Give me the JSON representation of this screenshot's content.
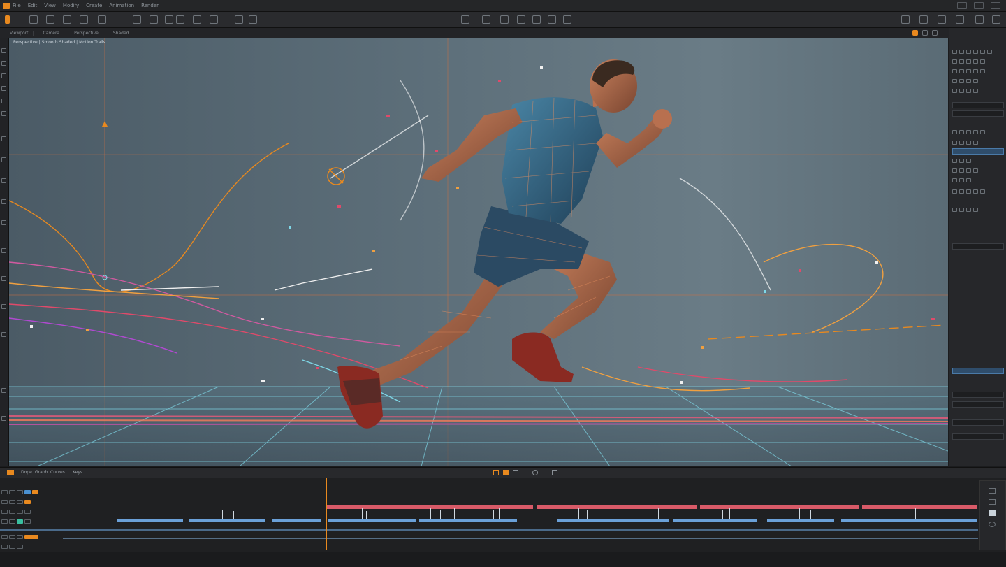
{
  "window": {
    "menu_items": [
      "File",
      "Edit",
      "View",
      "Modify",
      "Create",
      "Animation",
      "Render"
    ],
    "right_status": ""
  },
  "tabs": [
    "Viewport",
    "Camera",
    "Perspective",
    "Shaded"
  ],
  "viewport": {
    "overlay_left": "Perspective  |  Smooth Shaded  |  Motion Trails",
    "overlay_right_1": "",
    "overlay_right_2": "",
    "background_color": "#5d6f7a",
    "subject": "sprinting athlete with motion trails"
  },
  "right_panel": {
    "section_1": "",
    "section_2": "",
    "section_3": "",
    "section_4": "",
    "fields": [
      "",
      "",
      "",
      "",
      ""
    ]
  },
  "timeline": {
    "tabs": [
      "Dope",
      "Graph",
      "Curves",
      "Keys"
    ],
    "ruler_labels": [
      "",
      "",
      "",
      "",
      "",
      "",
      "",
      "",
      "",
      "",
      "",
      "",
      "",
      "",
      "",
      ""
    ],
    "tracks": 6,
    "accent": "#e8891f"
  },
  "statusbar": {
    "text": ""
  }
}
